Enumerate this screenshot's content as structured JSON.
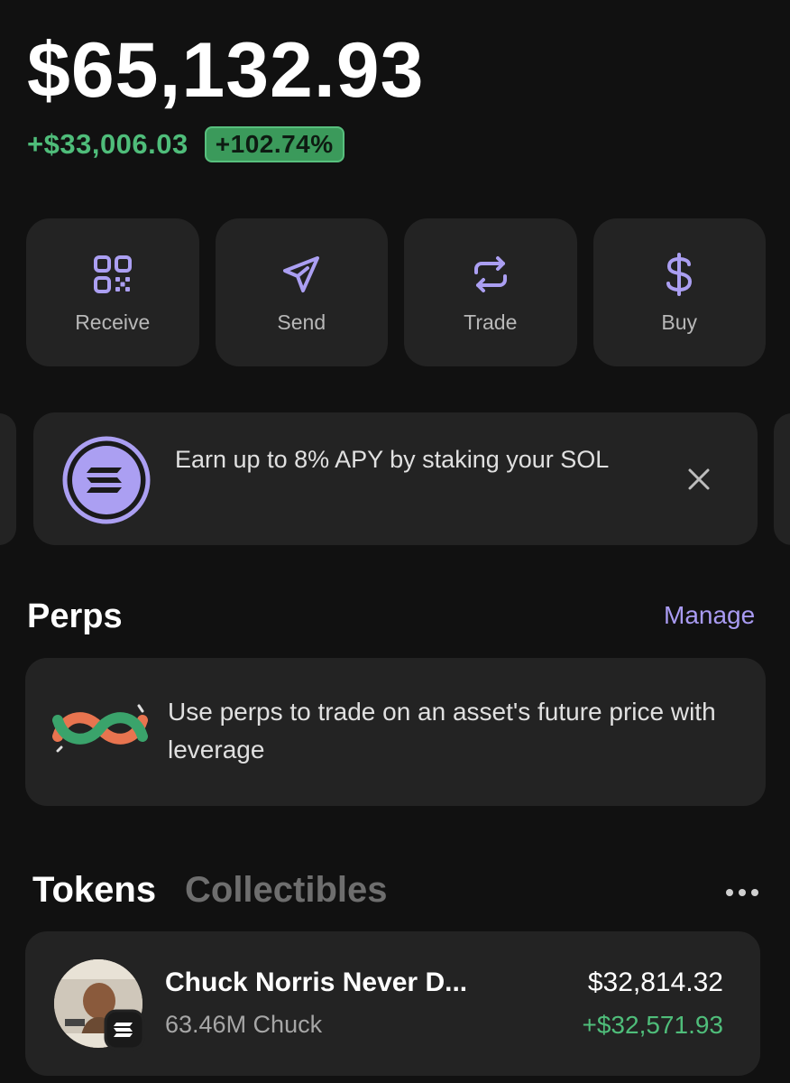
{
  "portfolio": {
    "balance": "$65,132.93",
    "change_amount": "+$33,006.03",
    "change_percent": "+102.74%"
  },
  "actions": [
    {
      "label": "Receive",
      "icon": "qr-code-icon"
    },
    {
      "label": "Send",
      "icon": "send-icon"
    },
    {
      "label": "Trade",
      "icon": "swap-arrows-icon"
    },
    {
      "label": "Buy",
      "icon": "dollar-icon"
    }
  ],
  "staking_banner": {
    "text": "Earn up to 8% APY by staking your SOL",
    "icon": "solana-logo-icon",
    "close_icon": "close-icon"
  },
  "perps": {
    "title": "Perps",
    "manage_label": "Manage",
    "description": "Use perps to trade on an asset's future price with leverage",
    "icon": "perps-logo-icon"
  },
  "tabs": {
    "tokens": "Tokens",
    "collectibles": "Collectibles",
    "more_icon": "more-horizontal-icon"
  },
  "tokens": [
    {
      "name": "Chuck Norris Never D...",
      "amount": "63.46M Chuck",
      "value": "$32,814.32",
      "change": "+$32,571.93",
      "avatar_icon": "token-avatar-icon",
      "badge_icon": "solana-badge-icon"
    }
  ],
  "colors": {
    "background": "#111111",
    "card": "#232323",
    "accent_purple": "#a99bf2",
    "positive_green": "#4fbd7a",
    "pill_green": "#3b9a5b"
  }
}
